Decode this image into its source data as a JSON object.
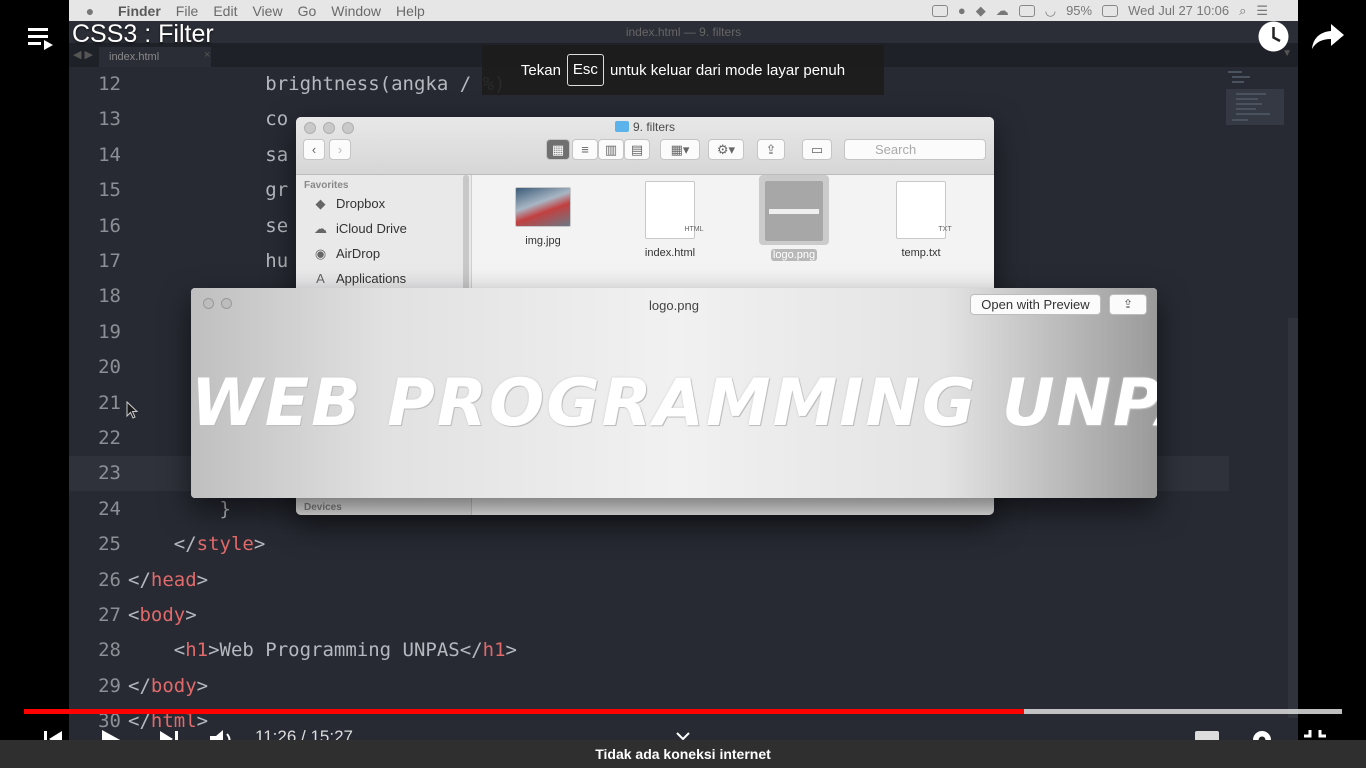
{
  "player": {
    "video_title": "CSS3 : Filter",
    "fullscreen_notice": {
      "prefix": "Tekan",
      "key": "Esc",
      "suffix": "untuk keluar dari mode layar penuh"
    },
    "time_display": "11:26 / 15:27",
    "progress_fraction": 0.7588,
    "buffered_fraction": 1.0,
    "offline_message": "Tidak ada koneksi internet",
    "icons": [
      "playlist-icon",
      "watch-later-icon",
      "share-icon",
      "previous-icon",
      "play-icon",
      "next-icon",
      "volume-icon",
      "chevron-down-icon",
      "subtitles-icon",
      "settings-icon",
      "exit-fullscreen-icon"
    ]
  },
  "mac_menubar": {
    "app": "Finder",
    "menus": [
      "File",
      "Edit",
      "View",
      "Go",
      "Window",
      "Help"
    ],
    "battery": "95%",
    "datetime": "Wed Jul 27  10:06"
  },
  "editor": {
    "window_title": "index.html — 9. filters",
    "tab": "index.html",
    "current_line": 23,
    "lines": [
      {
        "num": "12",
        "text": "            brightness(angka / %)"
      },
      {
        "num": "13",
        "text": "            co"
      },
      {
        "num": "14",
        "text": "            sa"
      },
      {
        "num": "15",
        "text": "            gr"
      },
      {
        "num": "16",
        "text": "            se"
      },
      {
        "num": "17",
        "text": "            hu"
      },
      {
        "num": "18",
        "text": ""
      },
      {
        "num": "19",
        "text": ""
      },
      {
        "num": "20",
        "text": ""
      },
      {
        "num": "21",
        "text": ""
      },
      {
        "num": "22",
        "text": ""
      },
      {
        "num": "23",
        "text": ""
      },
      {
        "num": "24",
        "text": "        }"
      },
      {
        "num": "25",
        "text": "    </style>"
      },
      {
        "num": "26",
        "text": "</head>"
      },
      {
        "num": "27",
        "text": "<body>"
      },
      {
        "num": "28",
        "text": "    <h1>Web Programming UNPAS</h1>"
      },
      {
        "num": "29",
        "text": "</body>"
      },
      {
        "num": "30",
        "text": "</html>"
      }
    ]
  },
  "finder": {
    "title": "9. filters",
    "search_placeholder": "Search",
    "sidebar": {
      "section": "Favorites",
      "items": [
        {
          "label": "Dropbox",
          "icon": "dropbox-icon"
        },
        {
          "label": "iCloud Drive",
          "icon": "cloud-icon"
        },
        {
          "label": "AirDrop",
          "icon": "airdrop-icon"
        },
        {
          "label": "Applications",
          "icon": "applications-icon"
        }
      ],
      "devices_section": "Devices"
    },
    "files": [
      {
        "name": "img.jpg",
        "kind": "photo",
        "ext": ""
      },
      {
        "name": "index.html",
        "kind": "doc",
        "ext": "HTML"
      },
      {
        "name": "logo.png",
        "kind": "logo",
        "ext": "",
        "selected": true
      },
      {
        "name": "temp.txt",
        "kind": "doc",
        "ext": "TXT"
      }
    ]
  },
  "quicklook": {
    "title": "logo.png",
    "open_button": "Open with Preview",
    "logo_text": "WEB PROGRAMMING UNPAS"
  }
}
